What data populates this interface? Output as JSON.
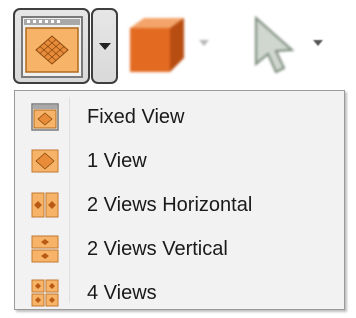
{
  "toolbar": {
    "buttons": [
      {
        "icon": "view-layout-icon",
        "selected": true
      },
      {
        "icon": "3d-cube-icon",
        "selected": false
      },
      {
        "icon": "pointer-arrow-icon",
        "selected": false
      }
    ]
  },
  "menu": {
    "items": [
      {
        "label": "Fixed View",
        "icon": "fixed-view-icon"
      },
      {
        "label": "1 View",
        "icon": "one-view-icon"
      },
      {
        "label": "2 Views Horizontal",
        "icon": "two-views-horizontal-icon"
      },
      {
        "label": "2 Views Vertical",
        "icon": "two-views-vertical-icon"
      },
      {
        "label": "4 Views",
        "icon": "four-views-icon"
      }
    ]
  },
  "colors": {
    "accent_orange": "#f5a14a",
    "cube_orange": "#e36a21",
    "menu_background": "#f2f2f2",
    "button_border": "#3f3f3f"
  }
}
